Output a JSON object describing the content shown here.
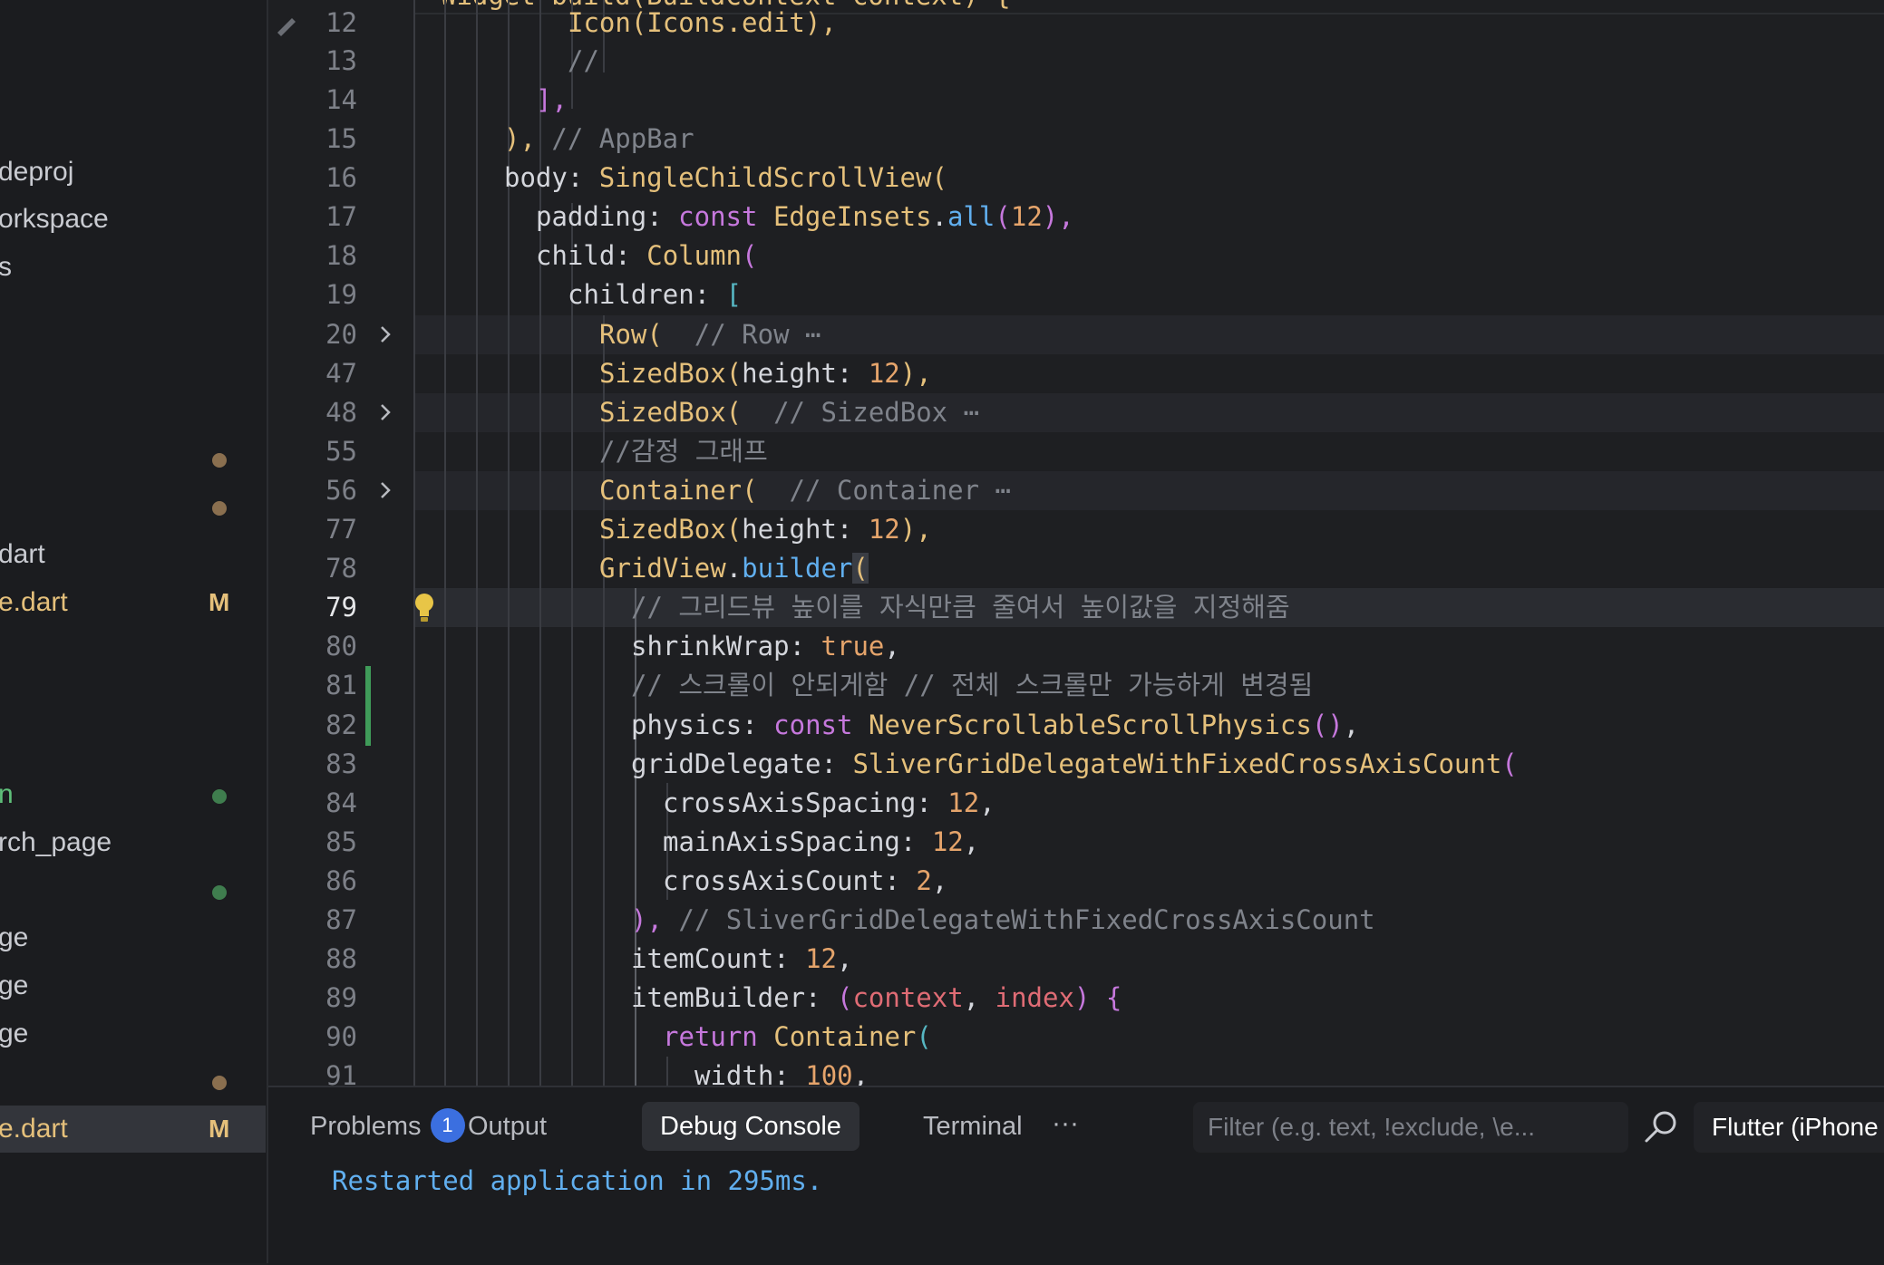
{
  "sidebar": {
    "files": [
      {
        "name": "deproj",
        "badge": "",
        "status": ""
      },
      {
        "name": "orkspace",
        "badge": "",
        "status": ""
      },
      {
        "name": "s",
        "badge": "",
        "status": ""
      },
      {
        "name": "",
        "badge": "",
        "status": "modified-dot"
      },
      {
        "name": "",
        "badge": "",
        "status": "modified-dot"
      },
      {
        "name": "dart",
        "badge": "",
        "status": ""
      },
      {
        "name": "e.dart",
        "badge": "M",
        "status": ""
      },
      {
        "name": "n",
        "badge": "",
        "status": "untracked-dot"
      },
      {
        "name": "rch_page",
        "badge": "",
        "status": ""
      },
      {
        "name": "",
        "badge": "",
        "status": "untracked-dot"
      },
      {
        "name": "ge",
        "badge": "",
        "status": ""
      },
      {
        "name": "ge",
        "badge": "",
        "status": ""
      },
      {
        "name": "ge",
        "badge": "",
        "status": ""
      },
      {
        "name": "",
        "badge": "",
        "status": "modified-dot"
      },
      {
        "name": "e.dart",
        "badge": "M",
        "status": "selected"
      }
    ],
    "colors": {
      "modified_dot": "#8a6f4f",
      "untracked_dot": "#3f7d4e",
      "badge": "#e5c07b"
    }
  },
  "editor": {
    "sticky_header": "Widget build(BuildContext context) {",
    "line_numbers": [
      "12",
      "13",
      "14",
      "15",
      "16",
      "17",
      "18",
      "19",
      "20",
      "47",
      "48",
      "55",
      "56",
      "77",
      "78",
      "79",
      "80",
      "81",
      "82",
      "83",
      "84",
      "85",
      "86",
      "87",
      "88",
      "89",
      "90",
      "91"
    ],
    "active_line": "79",
    "folded_lines": [
      "20",
      "48",
      "56"
    ],
    "lines": {
      "l12": "Icon(Icons.edit),",
      "l13": "//",
      "l14": "],",
      "l15_a": "),",
      "l15_b": "// AppBar",
      "l16_a": "body:",
      "l16_b": "SingleChildScrollView",
      "l16_c": "(",
      "l17_a": "padding:",
      "l17_b": "const",
      "l17_c": "EdgeInsets",
      "l17_d": ".",
      "l17_e": "all",
      "l17_f": "(",
      "l17_g": "12",
      "l17_h": "),",
      "l18_a": "child:",
      "l18_b": "Column",
      "l18_c": "(",
      "l19_a": "children:",
      "l19_b": "[",
      "l20_a": "Row(",
      "l20_b": "// Row",
      "l20_c": "⋯",
      "l47_a": "SizedBox",
      "l47_b": "(",
      "l47_c": "height:",
      "l47_d": "12",
      "l47_e": "),",
      "l48_a": "SizedBox(",
      "l48_b": "// SizedBox",
      "l48_c": "⋯",
      "l55": "//감정 그래프",
      "l56_a": "Container(",
      "l56_b": "// Container",
      "l56_c": "⋯",
      "l77_a": "SizedBox",
      "l77_b": "(",
      "l77_c": "height:",
      "l77_d": "12",
      "l77_e": "),",
      "l78_a": "GridView",
      "l78_b": ".",
      "l78_c": "builder",
      "l78_d": "(",
      "l79": "// 그리드뷰 높이를 자식만큼 줄여서 높이값을 지정해줌",
      "l80_a": "shrinkWrap:",
      "l80_b": "true",
      "l80_c": ",",
      "l81": "// 스크롤이 안되게함 // 전체 스크롤만 가능하게 변경됨",
      "l82_a": "physics:",
      "l82_b": "const",
      "l82_c": "NeverScrollableScrollPhysics",
      "l82_d": "()",
      "l82_e": ",",
      "l83_a": "gridDelegate:",
      "l83_b": "SliverGridDelegateWithFixedCrossAxisCount",
      "l83_c": "(",
      "l84_a": "crossAxisSpacing:",
      "l84_b": "12",
      "l84_c": ",",
      "l85_a": "mainAxisSpacing:",
      "l85_b": "12",
      "l85_c": ",",
      "l86_a": "crossAxisCount:",
      "l86_b": "2",
      "l86_c": ",",
      "l87_a": "),",
      "l87_b": "// SliverGridDelegateWithFixedCrossAxisCount",
      "l88_a": "itemCount:",
      "l88_b": "12",
      "l88_c": ",",
      "l89_a": "itemBuilder:",
      "l89_b": "(",
      "l89_c": "context",
      "l89_d": ",",
      "l89_e": "index",
      "l89_f": ")",
      "l89_g": "{",
      "l90_a": "return",
      "l90_b": "Container",
      "l90_c": "(",
      "l91_a": "width:",
      "l91_b": "100",
      "l91_c": ","
    }
  },
  "panel": {
    "tabs": [
      {
        "label": "Problems",
        "count": "1"
      },
      {
        "label": "Output"
      },
      {
        "label": "Debug Console",
        "active": true
      },
      {
        "label": "Terminal"
      }
    ],
    "more_label": "···",
    "filter_placeholder": "Filter (e.g. text, !exclude, \\e...",
    "target_label": "Flutter (iPhone",
    "console_output": "Restarted application in 295ms."
  }
}
